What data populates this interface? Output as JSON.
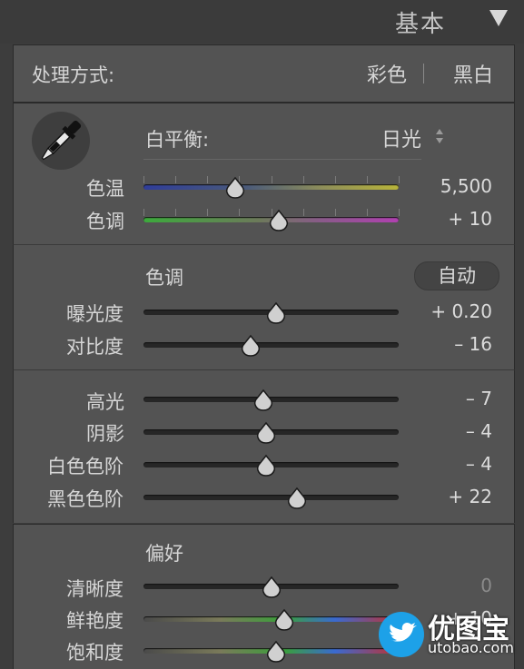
{
  "header": {
    "title": "基本"
  },
  "treatment": {
    "label": "处理方式:",
    "color": "彩色",
    "bw": "黑白"
  },
  "white_balance": {
    "label": "白平衡:",
    "preset": "日光",
    "temp": {
      "label": "色温",
      "value": "5,500",
      "position": 0.36
    },
    "tint": {
      "label": "色调",
      "value": "+ 10",
      "position": 0.53
    }
  },
  "tone": {
    "title": "色调",
    "auto": "自动",
    "exposure": {
      "label": "曝光度",
      "value": "+ 0.20",
      "position": 0.52
    },
    "contrast": {
      "label": "对比度",
      "value": "– 16",
      "position": 0.42
    },
    "highlights": {
      "label": "高光",
      "value": "– 7",
      "position": 0.47
    },
    "shadows": {
      "label": "阴影",
      "value": "– 4",
      "position": 0.48
    },
    "whites": {
      "label": "白色色阶",
      "value": "– 4",
      "position": 0.48
    },
    "blacks": {
      "label": "黑色色阶",
      "value": "+ 22",
      "position": 0.6
    }
  },
  "presence": {
    "title": "偏好",
    "clarity": {
      "label": "清晰度",
      "value": "0",
      "position": 0.5
    },
    "vibrance": {
      "label": "鲜艳度",
      "value": "+ 10",
      "position": 0.55
    },
    "saturation": {
      "label": "饱和度",
      "value": "",
      "position": 0.52
    }
  },
  "watermark": {
    "brand": "优图宝",
    "url": "utobao.com"
  },
  "colors": {
    "panel": "#535353",
    "background": "#3d3d3d",
    "text": "#d6d6d6"
  },
  "icons": {
    "eyedropper": "eyedropper-icon",
    "collapse": "triangle-down-icon",
    "stepper": "up-down-stepper-icon"
  }
}
